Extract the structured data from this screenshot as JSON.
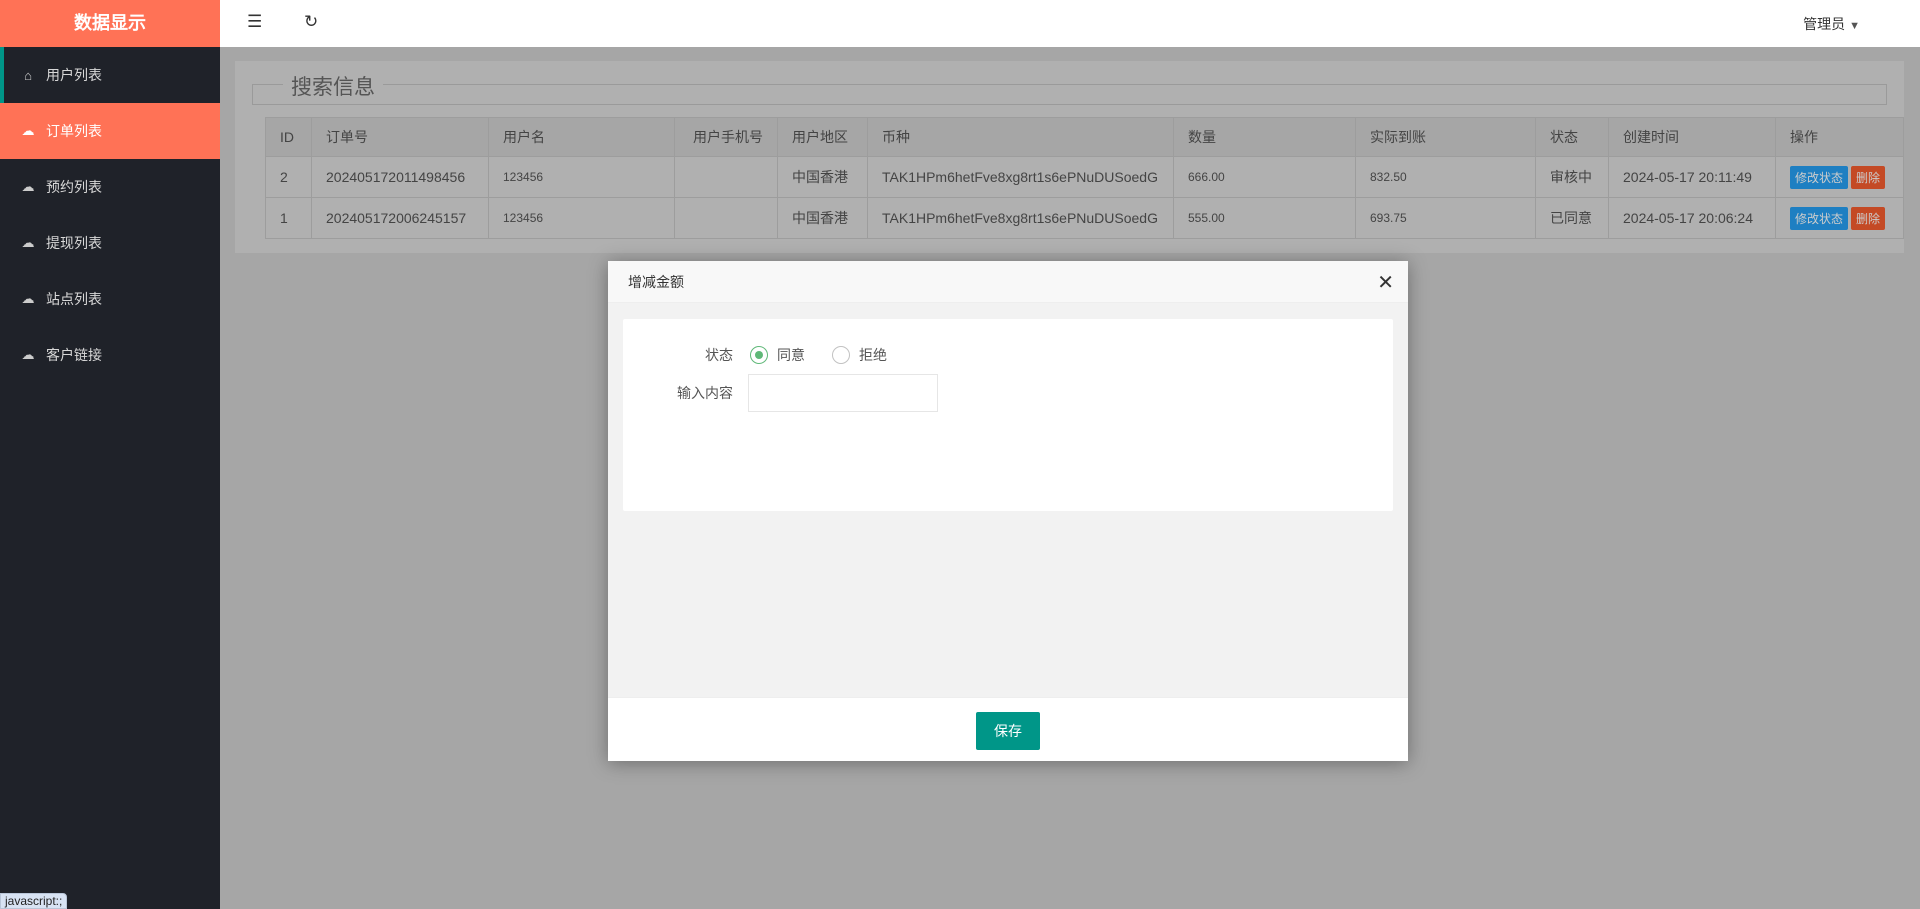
{
  "sidebar": {
    "logo": "数据显示",
    "items": [
      {
        "label": "用户列表",
        "icon": "home-icon"
      },
      {
        "label": "订单列表",
        "icon": "cloud-upload-icon"
      },
      {
        "label": "预约列表",
        "icon": "cloud-upload-icon"
      },
      {
        "label": "提现列表",
        "icon": "cloud-upload-icon"
      },
      {
        "label": "站点列表",
        "icon": "cloud-upload-icon"
      },
      {
        "label": "客户链接",
        "icon": "cloud-upload-icon"
      }
    ]
  },
  "topbar": {
    "collapse_icon": "☰",
    "refresh_icon": "↻",
    "user": "管理员",
    "caret": "▼"
  },
  "search": {
    "legend": "搜索信息"
  },
  "table": {
    "headers": [
      "ID",
      "订单号",
      "用户名",
      "用户手机号",
      "用户地区",
      "币种",
      "数量",
      "实际到账",
      "状态",
      "创建时间",
      "操作"
    ],
    "rows": [
      {
        "id": "2",
        "order": "202405172011498456",
        "user": "123456",
        "phone": "",
        "region": "中国香港",
        "currency": "TAK1HPm6hetFve8xg8rt1s6ePNuDUSoedG",
        "amount": "666.00",
        "actual": "832.50",
        "status": "审核中",
        "created": "2024-05-17 20:11:49"
      },
      {
        "id": "1",
        "order": "202405172006245157",
        "user": "123456",
        "phone": "",
        "region": "中国香港",
        "currency": "TAK1HPm6hetFve8xg8rt1s6ePNuDUSoedG",
        "amount": "555.00",
        "actual": "693.75",
        "status": "已同意",
        "created": "2024-05-17 20:06:24"
      }
    ],
    "edit_label": "修改状态",
    "delete_label": "删除"
  },
  "modal": {
    "title": "增减金额",
    "close": "✕",
    "status_label": "状态",
    "options": [
      "同意",
      "拒绝"
    ],
    "selected": "同意",
    "input_label": "输入内容",
    "input_value": "",
    "save": "保存"
  },
  "statusbar": "javascript:;"
}
